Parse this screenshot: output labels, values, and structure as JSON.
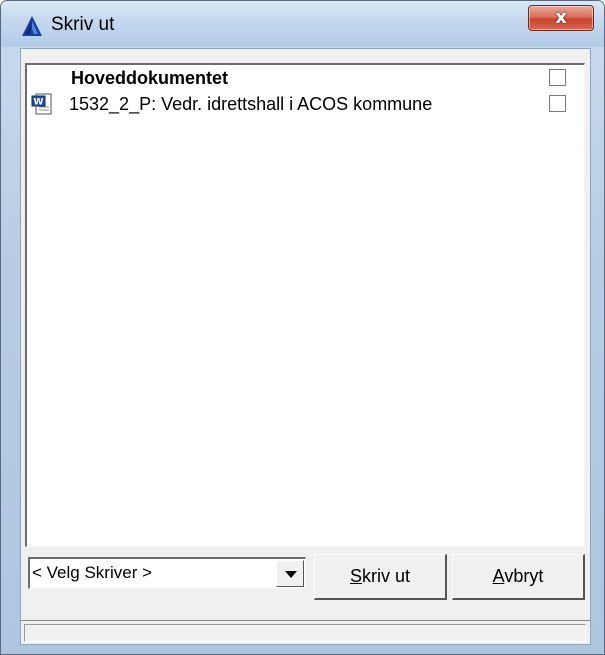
{
  "window": {
    "title": "Skriv ut",
    "close_glyph": "x",
    "icon": "acos-logo-icon"
  },
  "list": {
    "header_label": "Hoveddokumentet",
    "header_checked": false,
    "items": [
      {
        "icon": "word-document-icon",
        "label": "1532_2_P: Vedr. idrettshall i ACOS kommune",
        "checked": false
      }
    ]
  },
  "printer_select": {
    "value": "< Velg Skriver >"
  },
  "buttons": {
    "print_accel": "S",
    "print_rest": "kriv ut",
    "cancel_accel": "A",
    "cancel_rest": "vbryt"
  },
  "status": {
    "text": ""
  }
}
